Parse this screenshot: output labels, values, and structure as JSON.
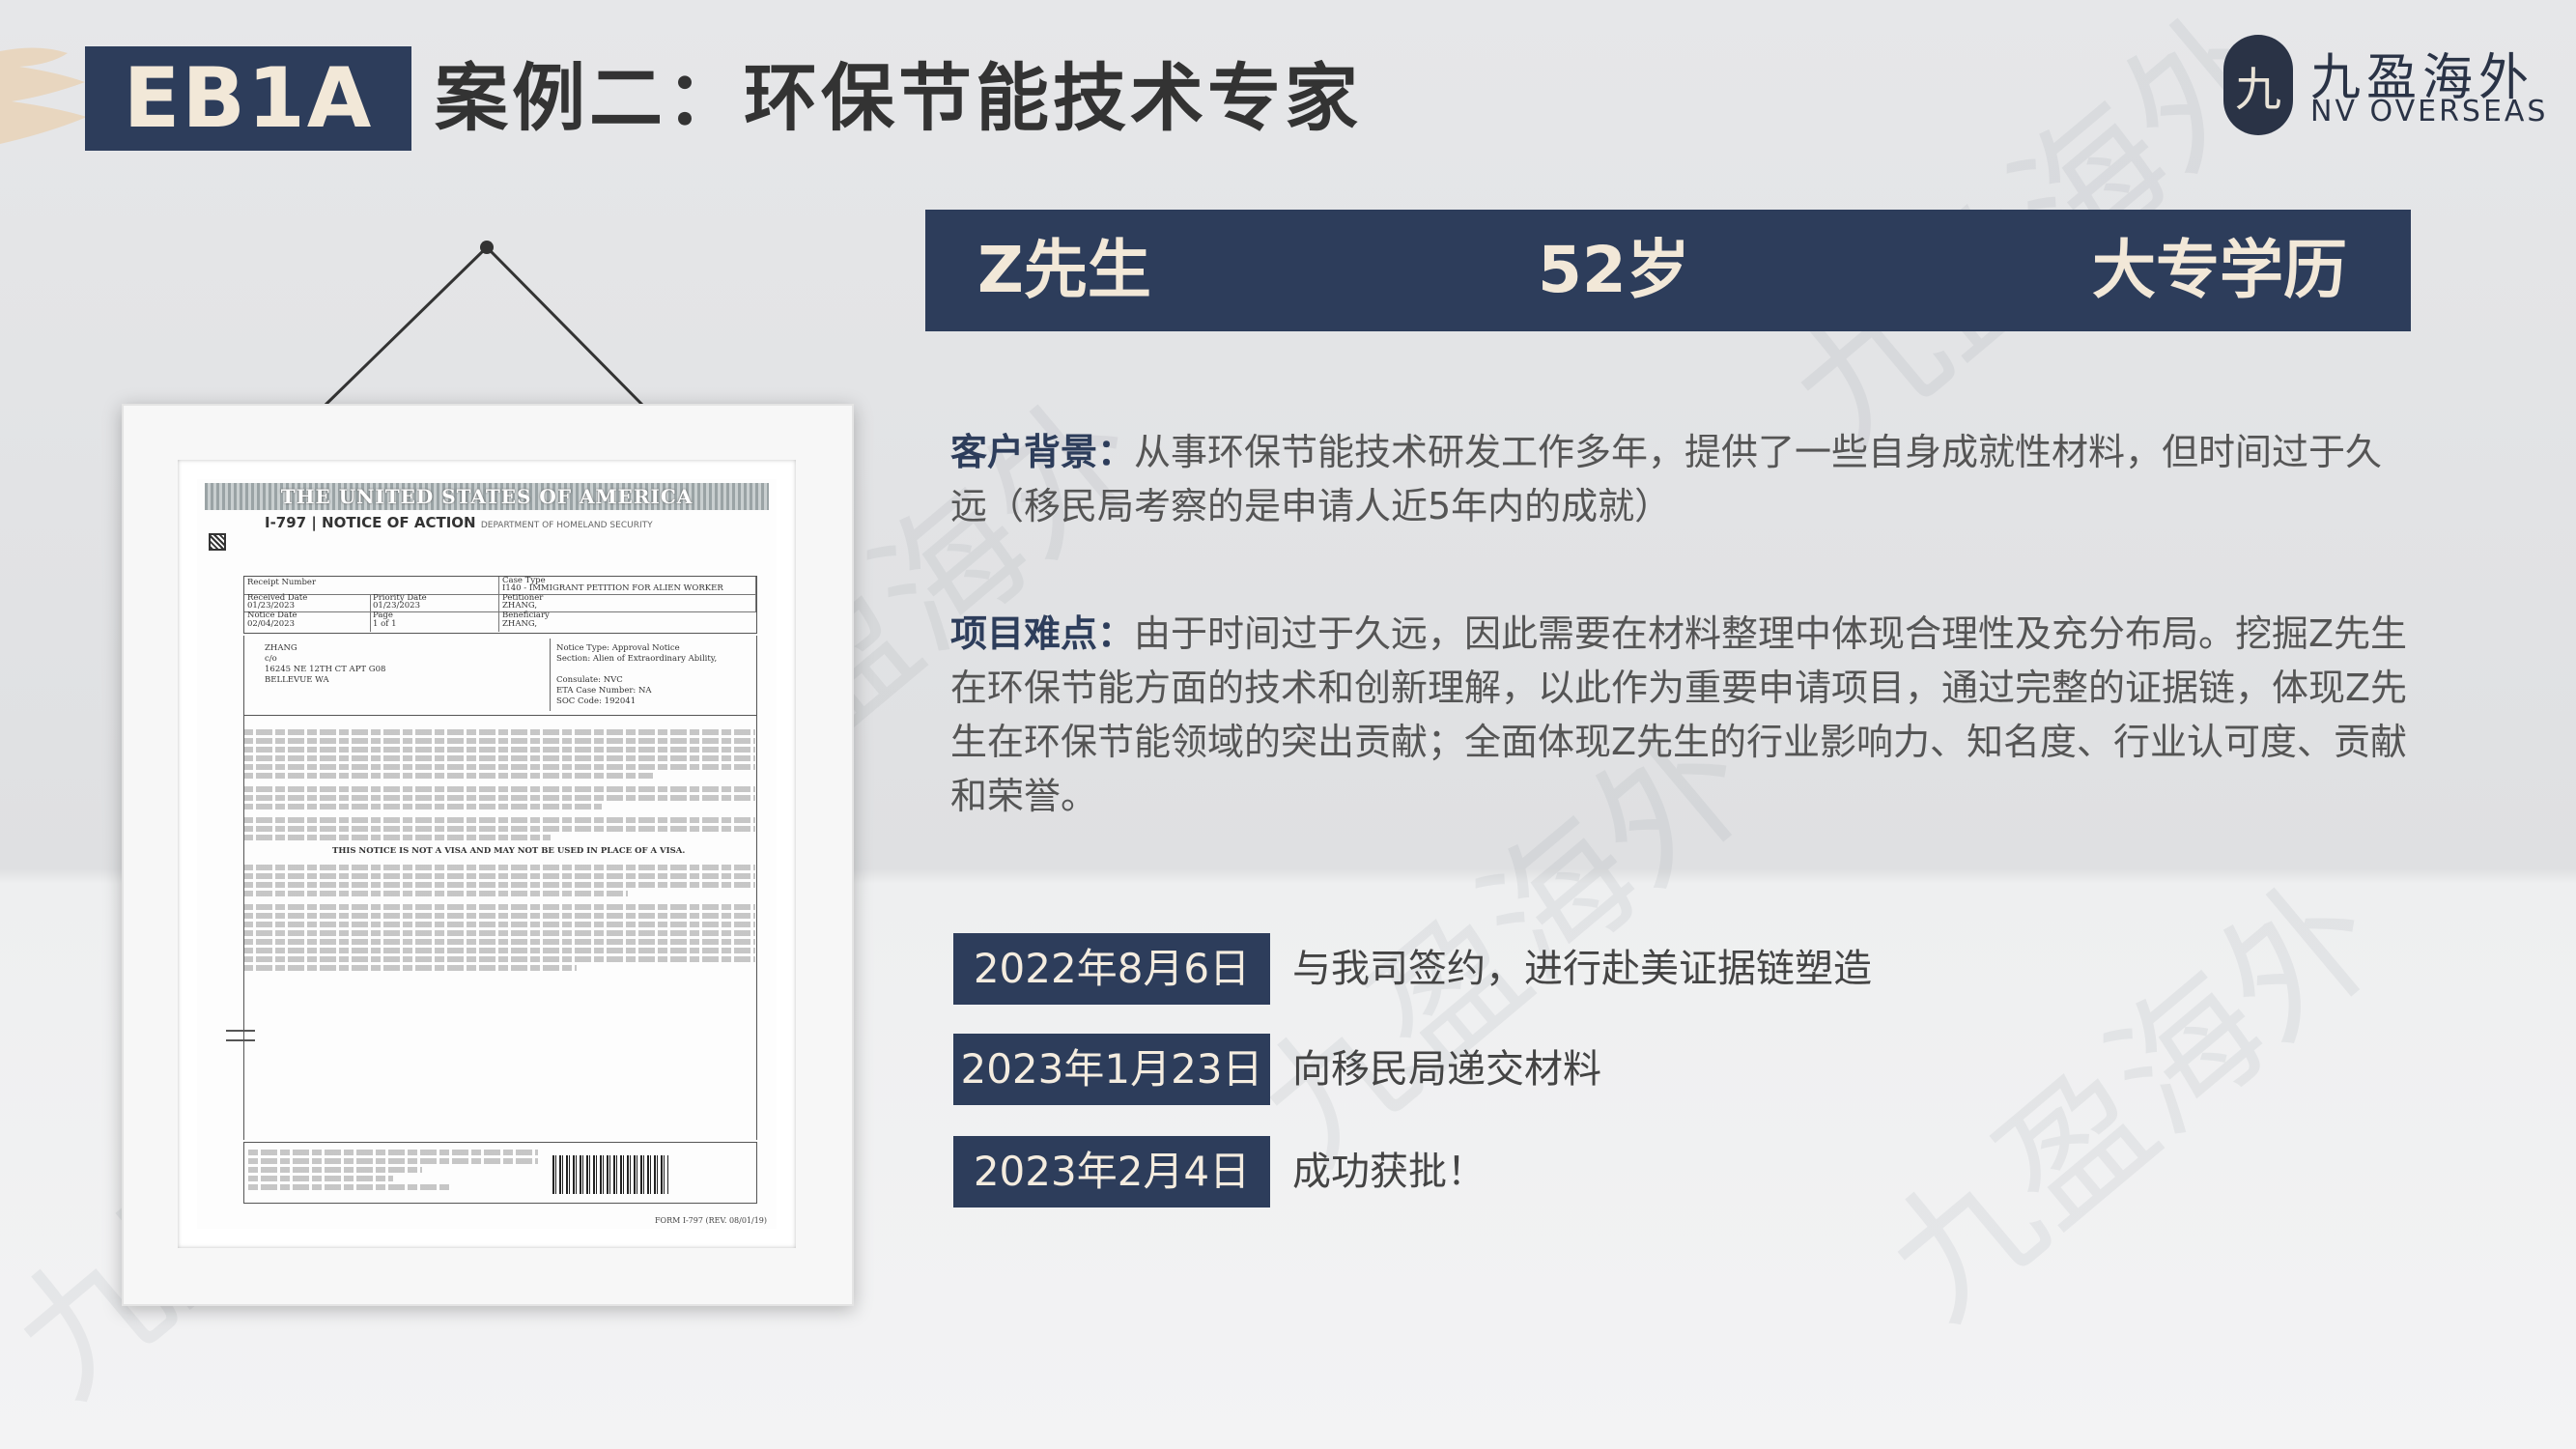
{
  "header": {
    "tag": "EB1A",
    "title": "案例二：环保节能技术专家"
  },
  "logo": {
    "mark": "九",
    "cn": "九盈海外",
    "en": "NV OVERSEAS"
  },
  "watermark": {
    "text": "九盈海外"
  },
  "document": {
    "banner": "THE UNITED STATES OF AMERICA",
    "heading": "I-797 | NOTICE OF ACTION",
    "department": "DEPARTMENT OF HOMELAND SECURITY",
    "receipt_label": "Receipt Number",
    "case_type_label": "Case Type",
    "case_type": "I140 - IMMIGRANT PETITION FOR ALIEN WORKER",
    "received_label": "Received Date",
    "received": "01/23/2023",
    "priority_label": "Priority Date",
    "priority": "01/23/2023",
    "petitioner_label": "Petitioner",
    "petitioner": "ZHANG,",
    "notice_date_label": "Notice Date",
    "notice_date": "02/04/2023",
    "page_label": "Page",
    "page": "1 of 1",
    "beneficiary_label": "Beneficiary",
    "beneficiary": "ZHANG,",
    "address": [
      "ZHANG",
      "c/o",
      "16245 NE 12TH CT APT G08",
      "BELLEVUE WA"
    ],
    "notice_type": "Notice Type: Approval Notice",
    "section": "Section: Alien of Extraordinary Ability,",
    "consulate": "Consulate: NVC",
    "eta": "ETA Case Number: NA",
    "soc": "SOC Code: 192041",
    "not_visa": "THIS NOTICE IS NOT A VISA AND MAY NOT BE USED IN PLACE OF A VISA.",
    "form_no": "FORM I-797 (REV. 08/01/19)"
  },
  "profile": {
    "name": "Z先生",
    "age": "52岁",
    "education": "大专学历"
  },
  "background": {
    "label": "客户背景：",
    "text": "从事环保节能技术研发工作多年，提供了一些自身成就性材料，但时间过于久远（移民局考察的是申请人近5年内的成就）"
  },
  "difficulty": {
    "label": "项目难点：",
    "text": "由于时间过于久远，因此需要在材料整理中体现合理性及充分布局。挖掘Z先生在环保节能方面的技术和创新理解，以此作为重要申请项目，通过完整的证据链，体现Z先生在环保节能领域的突出贡献；全面体现Z先生的行业影响力、知名度、行业认可度、贡献和荣誉。"
  },
  "timeline": [
    {
      "date": "2022年8月6日",
      "text": "与我司签约，进行赴美证据链塑造"
    },
    {
      "date": "2023年1月23日",
      "text": "向移民局递交材料"
    },
    {
      "date": "2023年2月4日",
      "text": "成功获批！"
    }
  ],
  "colors": {
    "navy": "#2d3d5b",
    "cream": "#f2e8d8",
    "background": "#e3e4e6"
  }
}
